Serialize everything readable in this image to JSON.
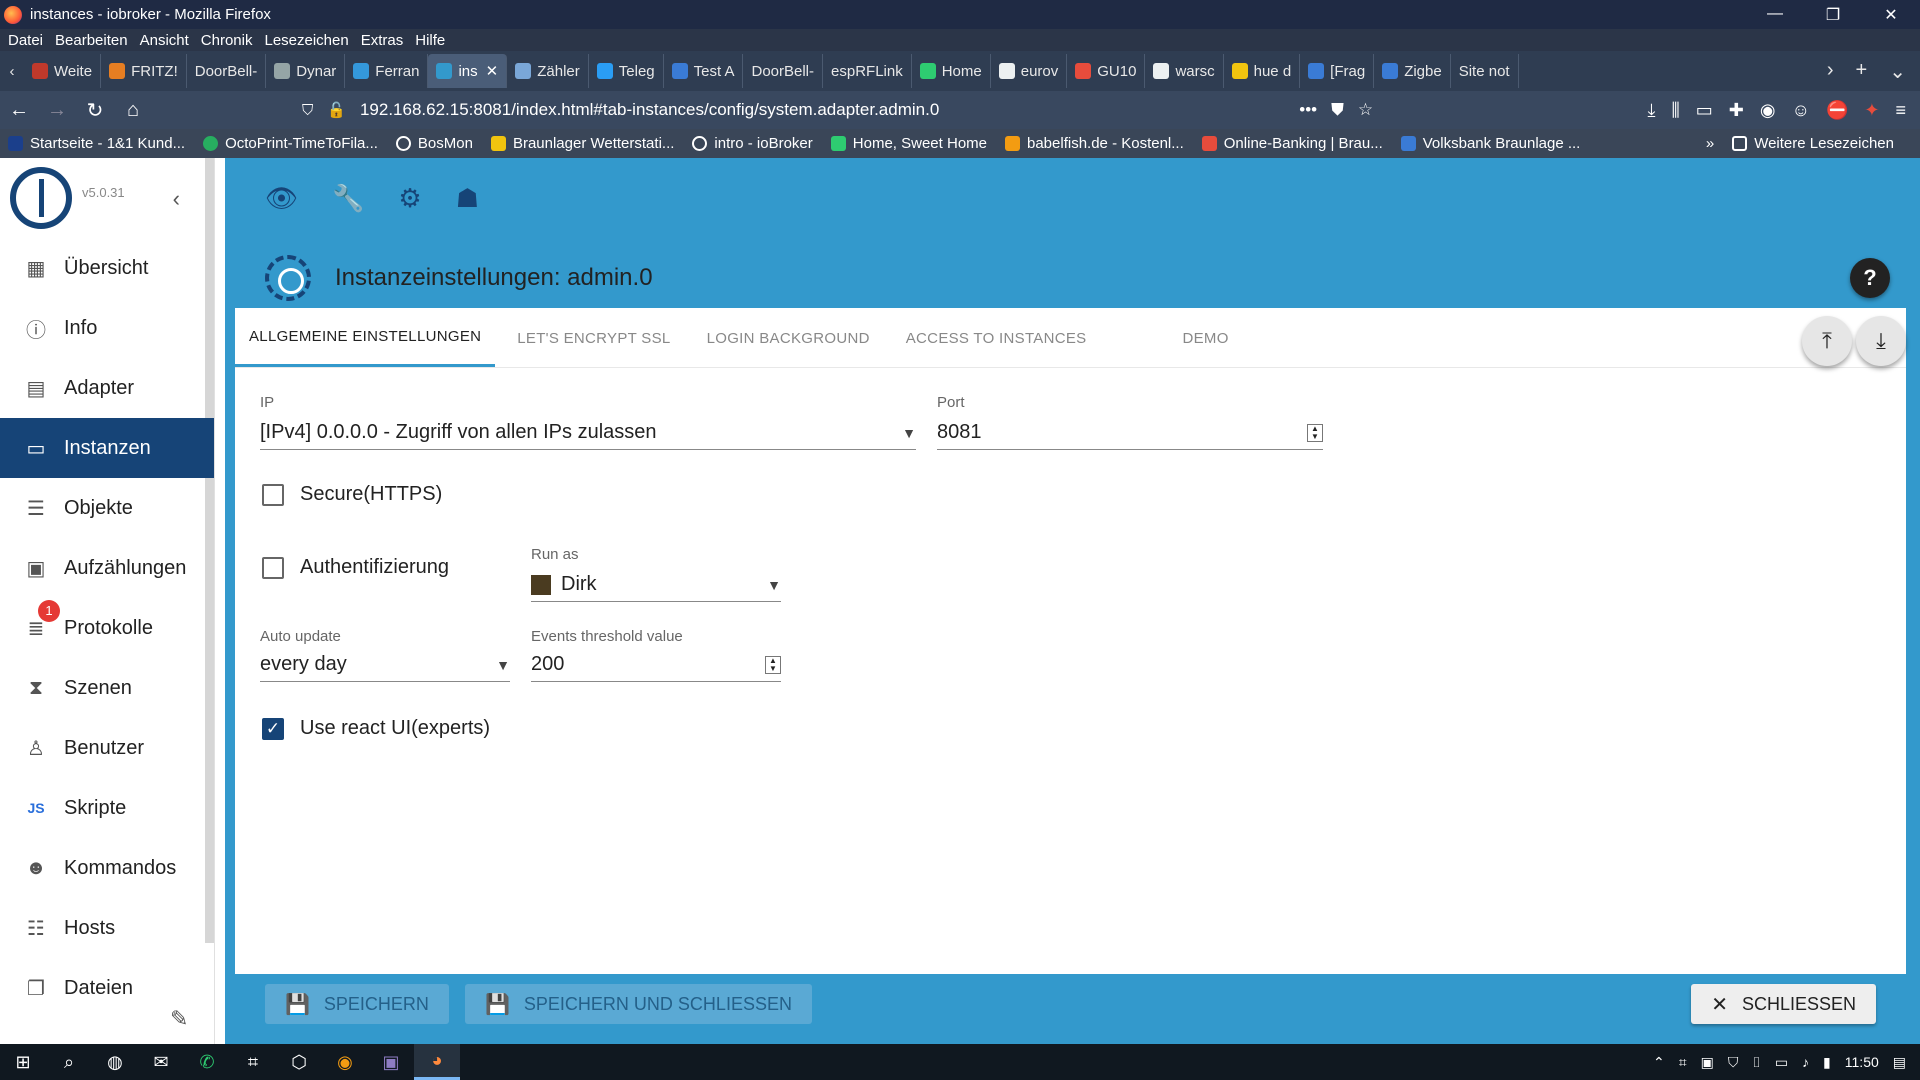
{
  "window": {
    "title": "instances - iobroker - Mozilla Firefox",
    "controls": [
      "—",
      "❐",
      "✕"
    ]
  },
  "menubar": [
    "Datei",
    "Bearbeiten",
    "Ansicht",
    "Chronik",
    "Lesezeichen",
    "Extras",
    "Hilfe"
  ],
  "tabs": [
    {
      "label": "Weite"
    },
    {
      "label": "FRITZ!"
    },
    {
      "label": "DoorBell-"
    },
    {
      "label": "Dynar"
    },
    {
      "label": "Ferran"
    },
    {
      "label": "ins",
      "active": true
    },
    {
      "label": "Zähler"
    },
    {
      "label": "Teleg"
    },
    {
      "label": "Test A"
    },
    {
      "label": "DoorBell-"
    },
    {
      "label": "espRFLink"
    },
    {
      "label": "Home"
    },
    {
      "label": "eurov"
    },
    {
      "label": "GU10"
    },
    {
      "label": "warsc"
    },
    {
      "label": "hue d"
    },
    {
      "label": "[Frag"
    },
    {
      "label": "Zigbe"
    },
    {
      "label": "Site not"
    }
  ],
  "navbar": {
    "url": "192.168.62.15:8081/index.html#tab-instances/config/system.adapter.admin.0"
  },
  "bookmarks": [
    "Startseite - 1&1 Kund...",
    "OctoPrint-TimeToFila...",
    "BosMon",
    "Braunlager Wetterstati...",
    "intro - ioBroker",
    "Home, Sweet Home",
    "babelfish.de - Kostenl...",
    "Online-Banking | Brau...",
    "Volksbank Braunlage ..."
  ],
  "bookmarks_more": "Weitere Lesezeichen",
  "app": {
    "version": "v5.0.31",
    "menu": [
      {
        "label": "Übersicht",
        "icon": "grid-icon"
      },
      {
        "label": "Info",
        "icon": "info-icon"
      },
      {
        "label": "Adapter",
        "icon": "store-icon"
      },
      {
        "label": "Instanzen",
        "icon": "instances-icon",
        "active": true
      },
      {
        "label": "Objekte",
        "icon": "list-icon"
      },
      {
        "label": "Aufzählungen",
        "icon": "enum-icon"
      },
      {
        "label": "Protokolle",
        "icon": "log-icon",
        "badge": "1"
      },
      {
        "label": "Szenen",
        "icon": "scenes-icon"
      },
      {
        "label": "Benutzer",
        "icon": "user-icon"
      },
      {
        "label": "Skripte",
        "icon": "js-icon"
      },
      {
        "label": "Kommandos",
        "icon": "commands-icon"
      },
      {
        "label": "Hosts",
        "icon": "hosts-icon"
      },
      {
        "label": "Dateien",
        "icon": "files-icon"
      }
    ],
    "panel_title": "Instanzeinstellungen: admin.0",
    "settings_tabs": [
      "ALLGEMEINE EINSTELLUNGEN",
      "LET'S ENCRYPT SSL",
      "LOGIN BACKGROUND",
      "ACCESS TO INSTANCES",
      "DEMO"
    ],
    "form": {
      "ip_label": "IP",
      "ip_value": "[IPv4] 0.0.0.0 - Zugriff von allen IPs zulassen",
      "port_label": "Port",
      "port_value": "8081",
      "secure_label": "Secure(HTTPS)",
      "secure_checked": false,
      "auth_label": "Authentifizierung",
      "auth_checked": false,
      "runas_label": "Run as",
      "runas_value": "Dirk",
      "autoupdate_label": "Auto update",
      "autoupdate_value": "every day",
      "events_label": "Events threshold value",
      "events_value": "200",
      "react_label": "Use react UI(experts)",
      "react_checked": true
    },
    "footer": {
      "save": "SPEICHERN",
      "save_close": "SPEICHERN UND SCHLIESSEN",
      "close": "SCHLIESSEN"
    }
  },
  "taskbar": {
    "time": "11:50"
  }
}
